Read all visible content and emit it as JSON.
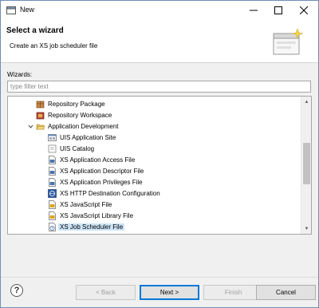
{
  "window": {
    "title": "New"
  },
  "titlebar_controls": {
    "minimize": "minimize-icon",
    "maximize": "maximize-icon",
    "close": "close-icon"
  },
  "header": {
    "title": "Select a wizard",
    "description": "Create an XS job scheduler file"
  },
  "wizards_label": "Wizards:",
  "filter": {
    "placeholder": "type filter text",
    "value": ""
  },
  "tree": {
    "items": [
      {
        "label": "Repository Package",
        "icon": "package-icon",
        "selected": false
      },
      {
        "label": "Repository Workspace",
        "icon": "workspace-icon",
        "selected": false
      },
      {
        "label": "Application Development",
        "icon": "folder-open-icon",
        "expanded": true,
        "selected": false
      },
      {
        "label": "UIS Application Site",
        "icon": "site-icon",
        "selected": false
      },
      {
        "label": "UIS Catalog",
        "icon": "catalog-icon",
        "selected": false
      },
      {
        "label": "XS Application Access File",
        "icon": "xs-file-icon",
        "selected": false
      },
      {
        "label": "XS Application Descriptor File",
        "icon": "xs-file-icon",
        "selected": false
      },
      {
        "label": "XS Application Privileges File",
        "icon": "xs-file-icon",
        "selected": false
      },
      {
        "label": "XS HTTP Destination Configuration",
        "icon": "xs-http-icon",
        "selected": false
      },
      {
        "label": "XS JavaScript File",
        "icon": "js-file-icon",
        "selected": false
      },
      {
        "label": "XS JavaScript Library File",
        "icon": "js-file-icon",
        "selected": false
      },
      {
        "label": "XS Job Scheduler File",
        "icon": "xs-job-icon",
        "selected": true
      }
    ]
  },
  "buttons": {
    "help": "?",
    "back": "< Back",
    "next": "Next >",
    "finish": "Finish",
    "cancel": "Cancel"
  }
}
